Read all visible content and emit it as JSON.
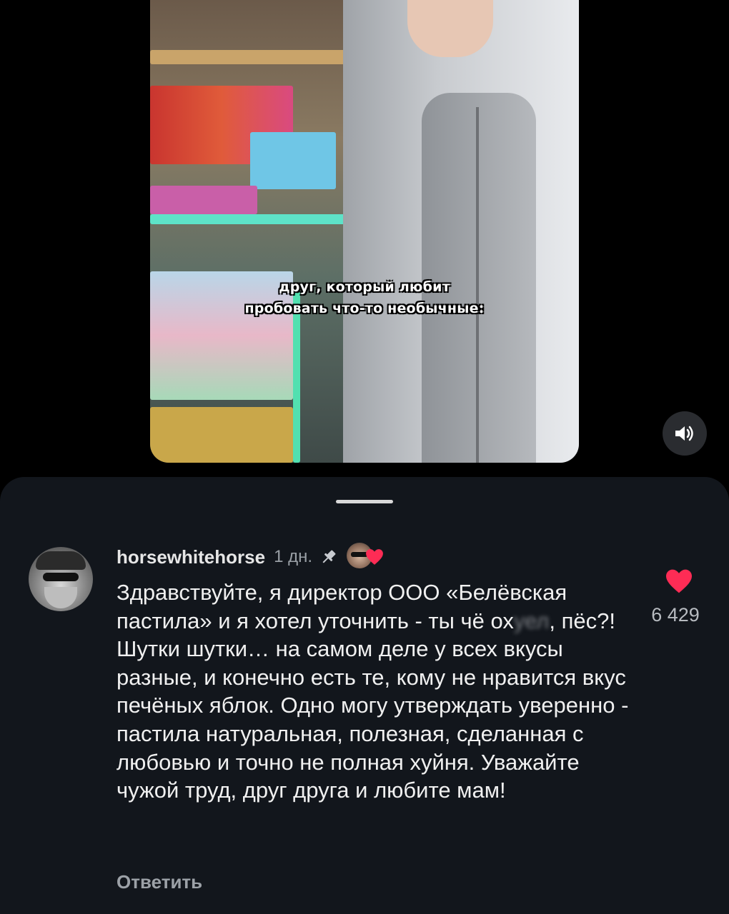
{
  "video": {
    "caption_line1": "друг, который любит",
    "caption_line2": "пробовать что-то необычные:"
  },
  "controls": {
    "sound_icon": "speaker-icon"
  },
  "comment": {
    "username": "horsewhitehorse",
    "time": "1 дн.",
    "pinned_icon": "pin-icon",
    "creator_liked_icon": "creator-heart-icon",
    "text_part1": "Здравствуйте, я директор ООО «Белёвская пастила» и я хотел уточнить - ты чё ох",
    "text_censored": "уел",
    "text_part2": ", пёс?! Шутки шутки… на самом деле у всех вкусы разные, и конечно есть те, кому не нравится вкус печёных яблок. Одно могу утверждать уверенно - пастила натуральная,  полезная, сделанная с любовью и точно не полная хуйня. Уважайте чужой труд, друг друга и любите мам!",
    "reply_label": "Ответить",
    "like_count": "6 429",
    "like_icon": "heart-icon"
  },
  "colors": {
    "background": "#000000",
    "sheet": "#12161c",
    "heart": "#fe2c55"
  }
}
